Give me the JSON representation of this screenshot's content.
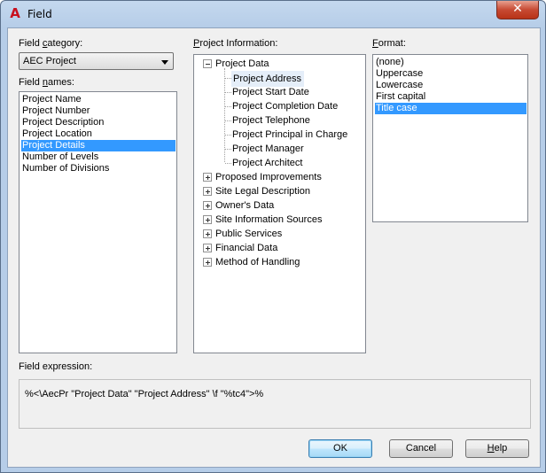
{
  "window": {
    "title": "Field",
    "close_glyph": "✕",
    "logo_glyph": "A"
  },
  "field_category": {
    "label_pre": "Field ",
    "label_u": "c",
    "label_post": "ategory:",
    "selected": "AEC Project"
  },
  "field_names": {
    "label_pre": "Field ",
    "label_u": "n",
    "label_post": "ames:",
    "items": [
      "Project Name",
      "Project Number",
      "Project Description",
      "Project Location",
      "Project Details",
      "Number of Levels",
      "Number of Divisions"
    ],
    "selected_index": 4
  },
  "project_information": {
    "label_u": "P",
    "label_post": "roject Information:",
    "root": {
      "label": "Project Data",
      "expanded": true,
      "expander": "−"
    },
    "children": [
      "Project Address",
      "Project Start Date",
      "Project Completion Date",
      "Project Telephone",
      "Project Principal in Charge",
      "Project Manager",
      "Project Architect"
    ],
    "selected_child": 0,
    "collapsed_groups": [
      "Proposed Improvements",
      "Site Legal Description",
      "Owner's Data",
      "Site Information Sources",
      "Public Services",
      "Financial Data",
      "Method of Handling"
    ]
  },
  "format": {
    "label_u": "F",
    "label_post": "ormat:",
    "items": [
      "(none)",
      "Uppercase",
      "Lowercase",
      "First capital",
      "Title case"
    ],
    "selected_index": 4
  },
  "field_expression": {
    "label": "Field expression:",
    "value": "%<\\AecPr \"Project Data\" \"Project Address\" \\f \"%tc4\">%"
  },
  "buttons": {
    "ok": "OK",
    "cancel": "Cancel",
    "help_u": "H",
    "help_post": "elp"
  }
}
